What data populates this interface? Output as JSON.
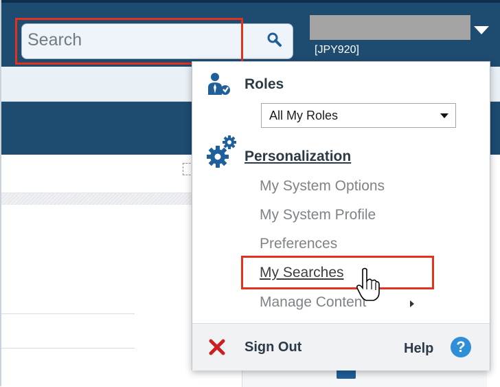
{
  "search": {
    "placeholder": "Search",
    "icon": "search-icon"
  },
  "user": {
    "id": "[JPY920]",
    "icon": "chevron-down-icon"
  },
  "menu": {
    "roles": {
      "label": "Roles",
      "icon": "roles-user-icon",
      "selected": "All My Roles"
    },
    "personalization": {
      "label": "Personalization",
      "icon": "gear-icon",
      "items": [
        "My System Options",
        "My System Profile",
        "Preferences",
        "My Searches",
        "Manage Content"
      ]
    },
    "footer": {
      "signout": "Sign Out",
      "help": "Help",
      "help_glyph": "?"
    }
  },
  "colors": {
    "header": "#1e4b70",
    "highlight": "#e2311d",
    "help_icon": "#2f8fd6",
    "signout_icon": "#cc1f1f"
  }
}
